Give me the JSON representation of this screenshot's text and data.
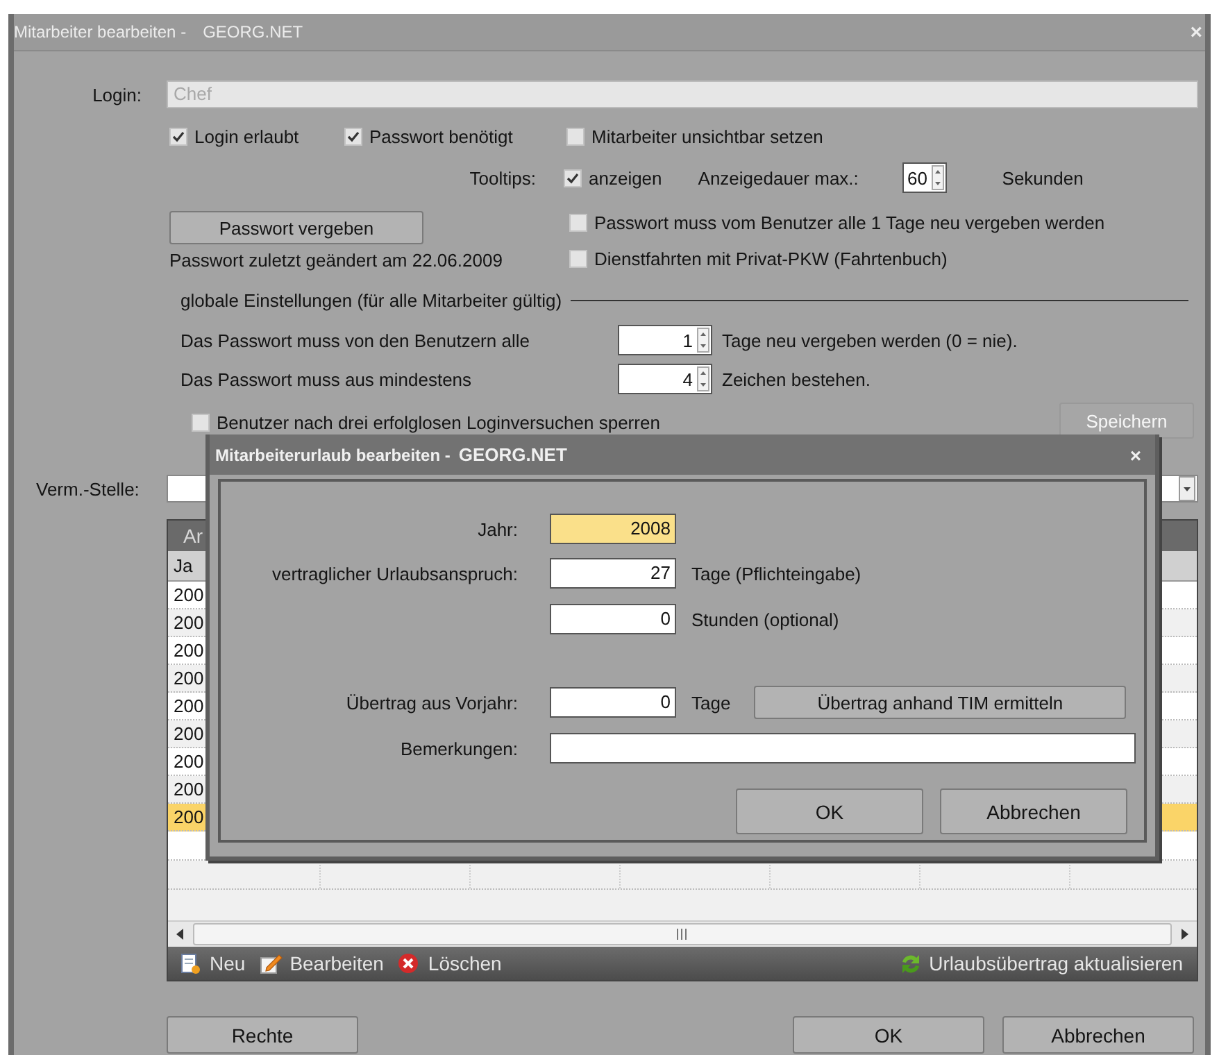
{
  "window": {
    "title": "Mitarbeiter bearbeiten -",
    "subtitle": "GEORG.NET",
    "close": "×"
  },
  "login": {
    "label": "Login:",
    "value": "Chef",
    "disabled": true
  },
  "checks_row": [
    {
      "label": "Login erlaubt",
      "checked": true
    },
    {
      "label": "Passwort benötigt",
      "checked": true
    },
    {
      "label": "Mitarbeiter unsichtbar setzen",
      "checked": false
    }
  ],
  "tooltips": {
    "label": "Tooltips:",
    "checkbox": {
      "label": "anzeigen",
      "checked": true
    },
    "duration_label": "Anzeigedauer max.:",
    "duration": "60",
    "unit": "Sekunden"
  },
  "password_button": "Passwort vergeben",
  "password_changed": "Passwort zuletzt geändert am 22.06.2009",
  "right_checks": [
    {
      "label": "Passwort muss vom Benutzer alle 1 Tage neu vergeben werden",
      "checked": false
    },
    {
      "label": "Dienstfahrten mit Privat-PKW (Fahrtenbuch)",
      "checked": false
    }
  ],
  "global": {
    "title": "globale Einstellungen (für alle Mitarbeiter gültig)",
    "rules": [
      {
        "label": "Das Passwort muss von den Benutzern alle",
        "value": "1",
        "suffix": "Tage neu vergeben werden (0 = nie)."
      },
      {
        "label": "Das Passwort muss aus mindestens",
        "value": "4",
        "suffix": "Zeichen bestehen."
      }
    ],
    "lockout": {
      "label": "Benutzer nach drei erfolglosen Loginversuchen sperren",
      "checked": false
    },
    "save_button": {
      "label": "Speichern",
      "disabled": true
    }
  },
  "verm_stelle": {
    "label": "Verm.-Stelle:"
  },
  "table": {
    "header": "Ar",
    "columns": [
      "Ja"
    ],
    "rows": [
      {
        "cells": [
          "200"
        ],
        "selected": false
      },
      {
        "cells": [
          "200"
        ],
        "selected": false
      },
      {
        "cells": [
          "200"
        ],
        "selected": false
      },
      {
        "cells": [
          "200"
        ],
        "selected": false
      },
      {
        "cells": [
          "200"
        ],
        "selected": false
      },
      {
        "cells": [
          "200"
        ],
        "selected": false
      },
      {
        "cells": [
          "200"
        ],
        "selected": false
      },
      {
        "cells": [
          "200"
        ],
        "selected": false
      },
      {
        "cells": [
          "200"
        ],
        "selected": true
      }
    ],
    "toolbar": [
      {
        "kind": "new",
        "label": "Neu"
      },
      {
        "kind": "edit",
        "label": "Bearbeiten"
      },
      {
        "kind": "delete",
        "label": "Löschen"
      }
    ],
    "toolbar_right": {
      "kind": "refresh",
      "label": "Urlaubsübertrag aktualisieren"
    }
  },
  "buttons_left": [
    "Rechte"
  ],
  "buttons": [
    "OK",
    "Abbrechen"
  ],
  "dialog": {
    "title": "Mitarbeiterurlaub bearbeiten -",
    "subtitle": "GEORG.NET",
    "close": "×",
    "fields": [
      {
        "label": "Jahr:",
        "value": "2008",
        "highlighted": true
      },
      {
        "label": "vertraglicher Urlaubsanspruch:",
        "value": "27",
        "unit": "Tage (Pflichteingabe)",
        "highlighted": false
      },
      {
        "value": "0",
        "unit": "Stunden (optional)",
        "highlighted": false
      },
      {
        "label": "Übertrag aus Vorjahr:",
        "value": "0",
        "unit": "Tage",
        "button": "Übertrag anhand TIM ermitteln",
        "highlighted": false
      },
      {
        "label": "Bemerkungen:",
        "wide": true,
        "highlighted": false
      }
    ],
    "buttons": [
      "OK",
      "Abbrechen"
    ]
  }
}
